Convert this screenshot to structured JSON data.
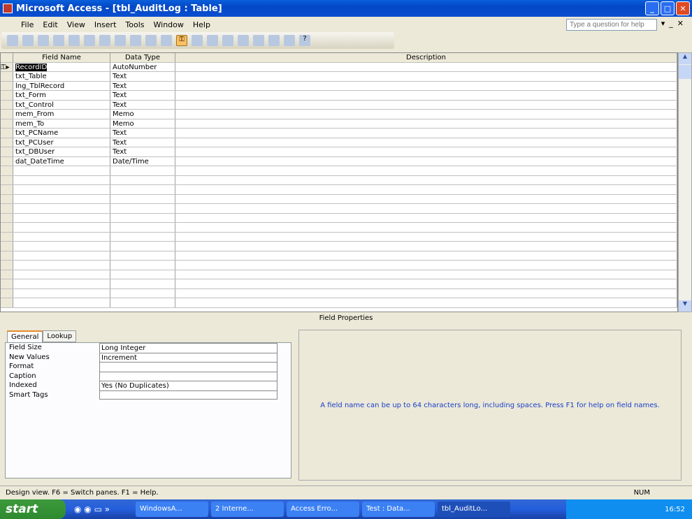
{
  "window": {
    "title": "Microsoft Access - [tbl_AuditLog : Table]"
  },
  "menu": [
    "File",
    "Edit",
    "View",
    "Insert",
    "Tools",
    "Window",
    "Help"
  ],
  "help_placeholder": "Type a question for help",
  "grid": {
    "headers": [
      "Field Name",
      "Data Type",
      "Description"
    ],
    "rows": [
      {
        "name": "RecordID",
        "type": "AutoNumber"
      },
      {
        "name": "txt_Table",
        "type": "Text"
      },
      {
        "name": "lng_TblRecord",
        "type": "Text"
      },
      {
        "name": "txt_Form",
        "type": "Text"
      },
      {
        "name": "txt_Control",
        "type": "Text"
      },
      {
        "name": "mem_From",
        "type": "Memo"
      },
      {
        "name": "mem_To",
        "type": "Memo"
      },
      {
        "name": "txt_PCName",
        "type": "Text"
      },
      {
        "name": "txt_PCUser",
        "type": "Text"
      },
      {
        "name": "txt_DBUser",
        "type": "Text"
      },
      {
        "name": "dat_DateTime",
        "type": "Date/Time"
      }
    ]
  },
  "field_properties": {
    "title": "Field Properties",
    "tabs": [
      "General",
      "Lookup"
    ],
    "props": [
      {
        "label": "Field Size",
        "value": "Long Integer"
      },
      {
        "label": "New Values",
        "value": "Increment"
      },
      {
        "label": "Format",
        "value": ""
      },
      {
        "label": "Caption",
        "value": ""
      },
      {
        "label": "Indexed",
        "value": "Yes (No Duplicates)"
      },
      {
        "label": "Smart Tags",
        "value": ""
      }
    ],
    "help": "A field name can be up to 64 characters long, including spaces.  Press F1 for help on field names."
  },
  "status": {
    "text": "Design view.  F6 = Switch panes.  F1 = Help.",
    "num": "NUM"
  },
  "taskbar": {
    "start": "start",
    "tasks": [
      "WindowsA...",
      "2 Interne...",
      "Access Erro...",
      "Test : Data...",
      "tbl_AuditLo..."
    ],
    "clock": "16:52"
  }
}
